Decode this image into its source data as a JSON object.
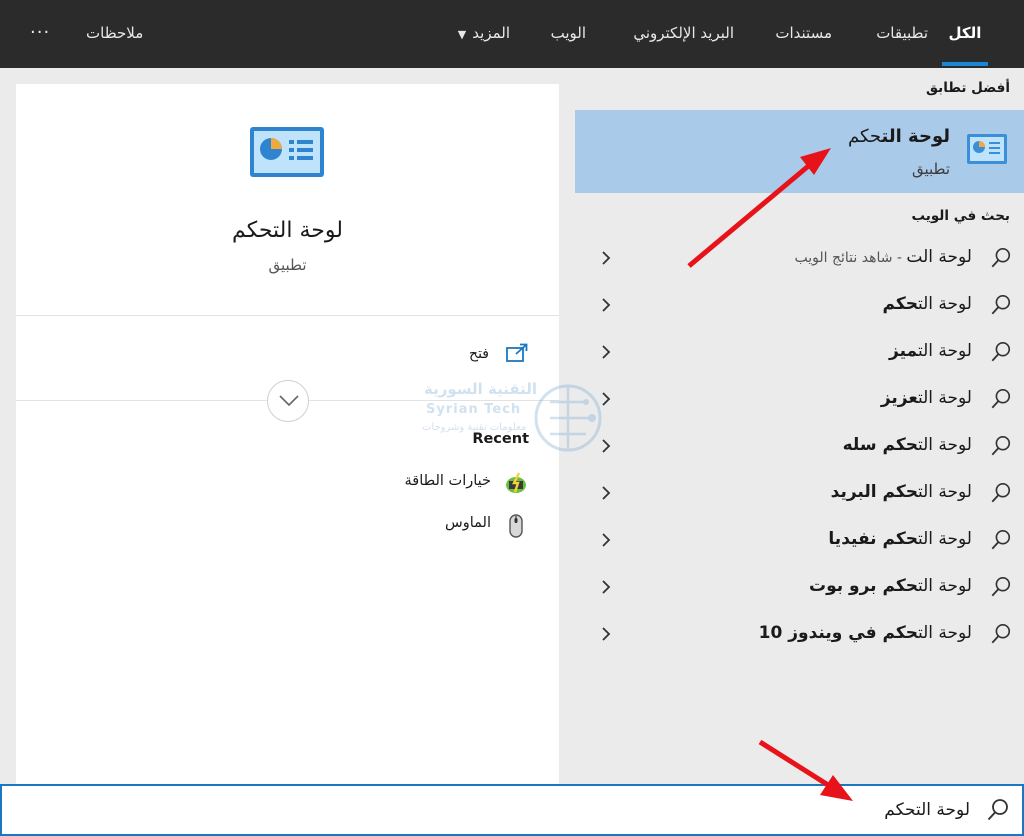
{
  "tabs": {
    "all": "الكل",
    "apps": "تطبيقات",
    "documents": "مستندات",
    "email": "البريد الإلكتروني",
    "web": "الويب",
    "more": "المزيد",
    "feedback": "ملاحظات",
    "ellipsis": "···"
  },
  "results": {
    "best_match_title": "أفضل تطابق",
    "best_match": {
      "name_match": "لوحة الت",
      "name_rest": "حكم",
      "type": "تطبيق"
    },
    "web_title": "بحث في الويب",
    "web_rows": [
      {
        "plain": "لوحة الت",
        "bold": "",
        "hint": " - شاهد نتائج الويب"
      },
      {
        "plain": "لوحة الت",
        "bold": "حكم",
        "hint": ""
      },
      {
        "plain": "لوحة الت",
        "bold": "ميز",
        "hint": ""
      },
      {
        "plain": "لوحة الت",
        "bold": "عزيز",
        "hint": ""
      },
      {
        "plain": "لوحة الت",
        "bold": "حكم سله",
        "hint": ""
      },
      {
        "plain": "لوحة الت",
        "bold": "حكم البريد",
        "hint": ""
      },
      {
        "plain": "لوحة الت",
        "bold": "حكم نفيديا",
        "hint": ""
      },
      {
        "plain": "لوحة الت",
        "bold": "حكم برو بوت",
        "hint": ""
      },
      {
        "plain": "لوحة الت",
        "bold": "حكم في ويندوز 10",
        "hint": ""
      }
    ]
  },
  "preview": {
    "title": "لوحة التحكم",
    "subtitle": "تطبيق",
    "open_label": "فتح",
    "recent_title": "Recent",
    "recent_items": [
      "خيارات الطاقة",
      "الماوس"
    ]
  },
  "watermark": {
    "arabic": "التقنية السورية",
    "english": "Syrian Tech",
    "tagline": "معلومات تقنية وشروحات"
  },
  "search": {
    "value": "لوحة التحكم"
  },
  "colors": {
    "topbar": "#2b2b2b",
    "accent": "#1a86d9",
    "selected": "#a9cbe9",
    "annotation": "#e8121a"
  }
}
